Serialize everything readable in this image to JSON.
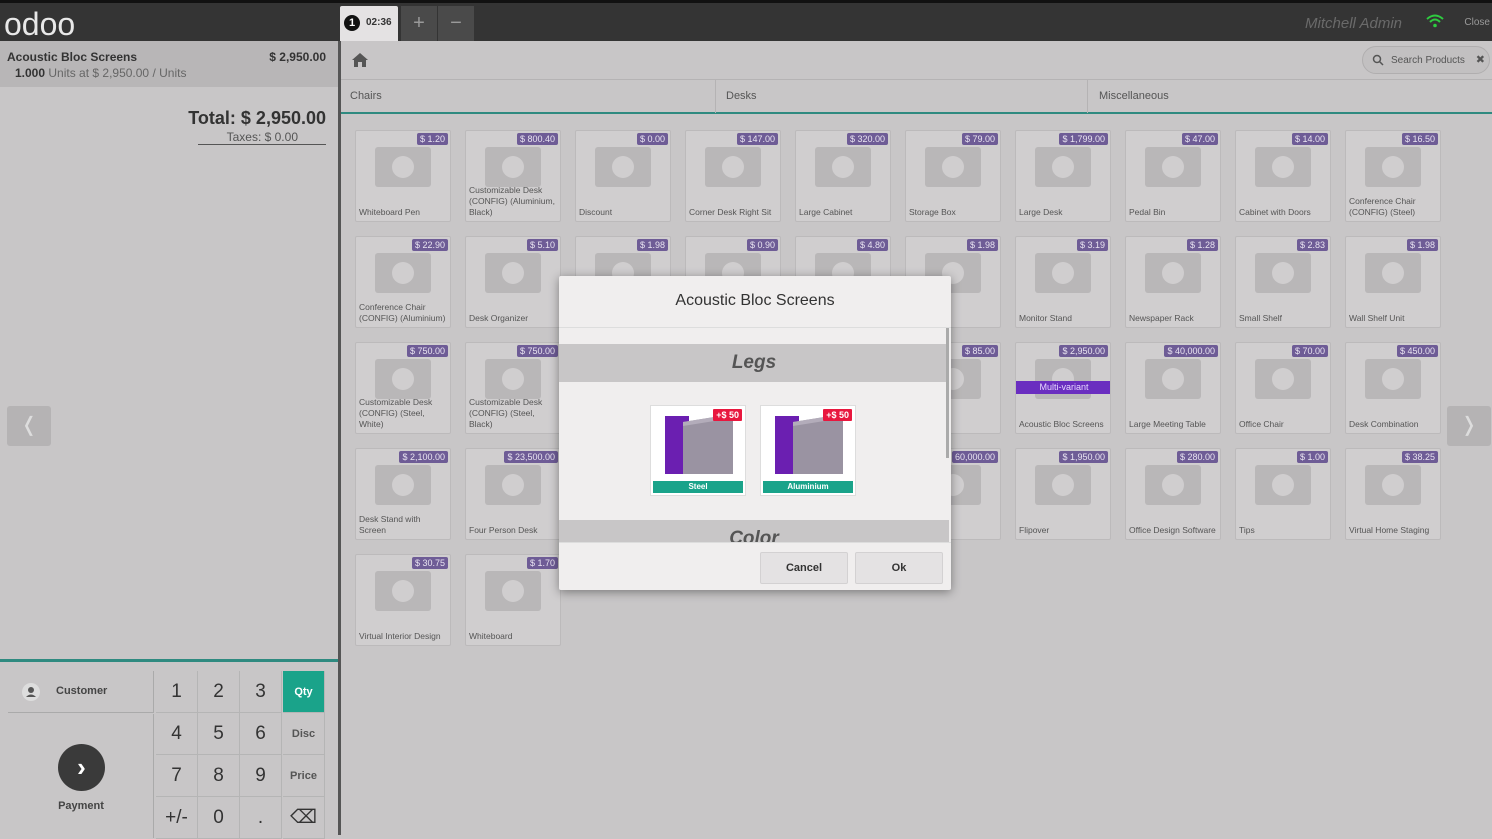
{
  "topbar": {
    "logo": "odoo",
    "order_number": "1",
    "order_time": "02:36",
    "add_label": "+",
    "remove_label": "−",
    "user": "Mitchell Admin",
    "close_label": "Close"
  },
  "order": {
    "line": {
      "name": "Acoustic Bloc Screens",
      "price": "$ 2,950.00",
      "qty": "1.000",
      "unit_info": "Units at $ 2,950.00 / Units"
    },
    "total": "Total: $ 2,950.00",
    "taxes": "Taxes: $ 0.00"
  },
  "pad": {
    "customer": "Customer",
    "payment": "Payment",
    "keys": [
      "1",
      "2",
      "3",
      "4",
      "5",
      "6",
      "7",
      "8",
      "9",
      "+/-",
      "0",
      "."
    ],
    "modes": [
      "Qty",
      "Disc",
      "Price"
    ],
    "backspace": "⌫"
  },
  "search": {
    "placeholder": "Search Products",
    "clear": "✖"
  },
  "categories": [
    "Chairs",
    "Desks",
    "Miscellaneous"
  ],
  "products": [
    {
      "name": "Whiteboard Pen",
      "price": "$ 1.20"
    },
    {
      "name": "Customizable Desk (CONFIG) (Aluminium, Black)",
      "price": "$ 800.40"
    },
    {
      "name": "Discount",
      "price": "$ 0.00"
    },
    {
      "name": "Corner Desk Right Sit",
      "price": "$ 147.00"
    },
    {
      "name": "Large Cabinet",
      "price": "$ 320.00"
    },
    {
      "name": "Storage Box",
      "price": "$ 79.00"
    },
    {
      "name": "Large Desk",
      "price": "$ 1,799.00"
    },
    {
      "name": "Pedal Bin",
      "price": "$ 47.00"
    },
    {
      "name": "Cabinet with Doors",
      "price": "$ 14.00"
    },
    {
      "name": "Conference Chair (CONFIG) (Steel)",
      "price": "$ 16.50"
    },
    {
      "name": "Conference Chair (CONFIG) (Aluminium)",
      "price": "$ 22.90"
    },
    {
      "name": "Desk Organizer",
      "price": "$ 5.10"
    },
    {
      "name": "",
      "price": "$ 1.98"
    },
    {
      "name": "",
      "price": "$ 0.90"
    },
    {
      "name": "",
      "price": "$ 4.80"
    },
    {
      "name": "oard",
      "price": "$ 1.98"
    },
    {
      "name": "Monitor Stand",
      "price": "$ 3.19"
    },
    {
      "name": "Newspaper Rack",
      "price": "$ 1.28"
    },
    {
      "name": "Small Shelf",
      "price": "$ 2.83"
    },
    {
      "name": "Wall Shelf Unit",
      "price": "$ 1.98"
    },
    {
      "name": "Customizable Desk (CONFIG) (Steel, White)",
      "price": "$ 750.00"
    },
    {
      "name": "Customizable Desk (CONFIG) (Steel, Black)",
      "price": "$ 750.00"
    },
    {
      "name": "",
      "price": ""
    },
    {
      "name": "",
      "price": ""
    },
    {
      "name": "",
      "price": ""
    },
    {
      "name": "k Black",
      "price": "$ 85.00"
    },
    {
      "name": "Acoustic Bloc Screens",
      "price": "$ 2,950.00",
      "ribbon": "Multi-variant"
    },
    {
      "name": "Large Meeting Table",
      "price": "$ 40,000.00"
    },
    {
      "name": "Office Chair",
      "price": "$ 70.00"
    },
    {
      "name": "Desk Combination",
      "price": "$ 450.00"
    },
    {
      "name": "Desk Stand with Screen",
      "price": "$ 2,100.00"
    },
    {
      "name": "Four Person Desk",
      "price": "$ 23,500.00"
    },
    {
      "name": "",
      "price": ""
    },
    {
      "name": "",
      "price": ""
    },
    {
      "name": "",
      "price": ""
    },
    {
      "name": "Sofa",
      "price": "60,000.00"
    },
    {
      "name": "Flipover",
      "price": "$ 1,950.00"
    },
    {
      "name": "Office Design Software",
      "price": "$ 280.00"
    },
    {
      "name": "Tips",
      "price": "$ 1.00"
    },
    {
      "name": "Virtual Home Staging",
      "price": "$ 38.25"
    },
    {
      "name": "Virtual Interior Design",
      "price": "$ 30.75"
    },
    {
      "name": "Whiteboard",
      "price": "$ 1.70"
    }
  ],
  "dialog": {
    "title": "Acoustic Bloc Screens",
    "attribute1": "Legs",
    "attribute2": "Color",
    "variants": [
      {
        "label": "Steel",
        "extra": "+$ 50"
      },
      {
        "label": "Aluminium",
        "extra": "+$ 50"
      }
    ],
    "cancel": "Cancel",
    "ok": "Ok"
  },
  "nav": {
    "prev": "❬",
    "next": "❭"
  },
  "colors": {
    "accent": "#1aa38a",
    "price_tag": "#6e5c96",
    "extra_badge": "#e8173e"
  }
}
